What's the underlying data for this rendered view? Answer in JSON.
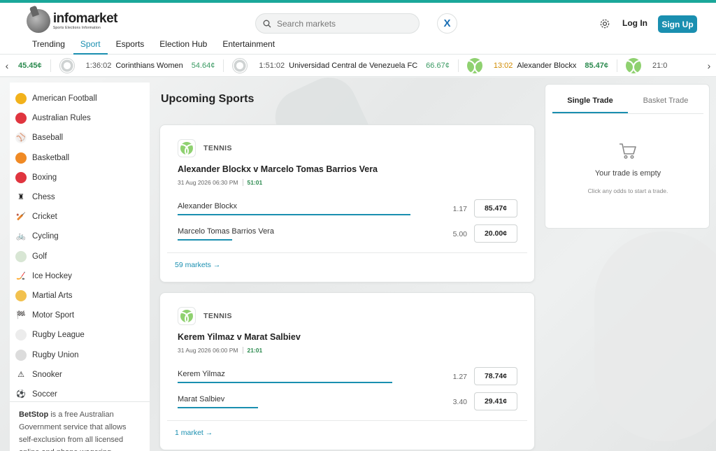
{
  "brand": {
    "name": "infomarket",
    "tagline": "Sports Elections Information"
  },
  "header": {
    "search_placeholder": "Search markets",
    "x_label": "X",
    "login_label": "Log In",
    "signup_label": "Sign Up"
  },
  "nav": {
    "tabs": [
      {
        "label": "Trending",
        "active": false
      },
      {
        "label": "Sport",
        "active": true
      },
      {
        "label": "Esports",
        "active": false
      },
      {
        "label": "Election Hub",
        "active": false
      },
      {
        "label": "Entertainment",
        "active": false
      }
    ]
  },
  "ticker": {
    "prev": "‹",
    "next": "›",
    "items": [
      {
        "price": "45.45¢"
      },
      {
        "ball": "soccer",
        "time": "1:36:02",
        "team": "Corinthians Women",
        "price": "54.64¢"
      },
      {
        "ball": "soccer",
        "time": "1:51:02",
        "team": "Universidad Central de Venezuela FC",
        "price": "66.67¢"
      },
      {
        "ball": "tennis",
        "time": "13:02",
        "team": "Alexander Blockx",
        "price": "85.47¢"
      },
      {
        "ball": "tennis",
        "time": "21:0"
      }
    ]
  },
  "sidebar": {
    "sports": [
      {
        "label": "American Football",
        "icon": "football-helmet-icon",
        "color": "#f2b21c",
        "glyph": ""
      },
      {
        "label": "Australian Rules",
        "icon": "australian-rules-ball-icon",
        "color": "#e0353f",
        "glyph": ""
      },
      {
        "label": "Baseball",
        "icon": "baseball-icon",
        "color": "#f4f4f4",
        "glyph": "⚾"
      },
      {
        "label": "Basketball",
        "icon": "basketball-icon",
        "color": "#f08a24",
        "glyph": ""
      },
      {
        "label": "Boxing",
        "icon": "boxing-glove-icon",
        "color": "#e0353f",
        "glyph": ""
      },
      {
        "label": "Chess",
        "icon": "chess-piece-icon",
        "color": "#ffffff",
        "glyph": "♜"
      },
      {
        "label": "Cricket",
        "icon": "cricket-bat-icon",
        "color": "#ffffff",
        "glyph": "🏏"
      },
      {
        "label": "Cycling",
        "icon": "bicycle-icon",
        "color": "#ffffff",
        "glyph": "🚲"
      },
      {
        "label": "Golf",
        "icon": "golf-ball-icon",
        "color": "#d8e6d4",
        "glyph": ""
      },
      {
        "label": "Ice Hockey",
        "icon": "hockey-sticks-icon",
        "color": "#ffffff",
        "glyph": "🏒"
      },
      {
        "label": "Martial Arts",
        "icon": "martial-arts-icon",
        "color": "#f2c14e",
        "glyph": ""
      },
      {
        "label": "Motor Sport",
        "icon": "checkered-flag-icon",
        "color": "#ffffff",
        "glyph": "🏁"
      },
      {
        "label": "Rugby League",
        "icon": "rugby-league-ball-icon",
        "color": "#ececec",
        "glyph": ""
      },
      {
        "label": "Rugby Union",
        "icon": "rugby-union-ball-icon",
        "color": "#dcdcdc",
        "glyph": ""
      },
      {
        "label": "Snooker",
        "icon": "snooker-triangle-icon",
        "color": "#ffffff",
        "glyph": "⚠"
      },
      {
        "label": "Soccer",
        "icon": "soccer-ball-icon",
        "color": "#ffffff",
        "glyph": "⚽"
      }
    ],
    "betstop": {
      "name": "BetStop",
      "text": " is a free Australian Government service that allows self-exclusion from all licensed online and phone wagering"
    }
  },
  "main": {
    "title": "Upcoming Sports",
    "cards": [
      {
        "category": "TENNIS",
        "title": "Alexander Blockx v Marcelo Tomas Barrios Vera",
        "date": "31 Aug 2026 06:30 PM",
        "countdown": "51:01",
        "runners": [
          {
            "name": "Alexander Blockx",
            "odds": "1.17",
            "price": "85.47¢",
            "share": 0.8547
          },
          {
            "name": "Marcelo Tomas Barrios Vera",
            "odds": "5.00",
            "price": "20.00¢",
            "share": 0.2
          }
        ],
        "markets_link": "59 markets →"
      },
      {
        "category": "TENNIS",
        "title": "Kerem Yilmaz v Marat Salbiev",
        "date": "31 Aug 2026 06:00 PM",
        "countdown": "21:01",
        "runners": [
          {
            "name": "Kerem Yilmaz",
            "odds": "1.27",
            "price": "78.74¢",
            "share": 0.7874
          },
          {
            "name": "Marat Salbiev",
            "odds": "3.40",
            "price": "29.41¢",
            "share": 0.2941
          }
        ],
        "markets_link": "1 market →"
      }
    ]
  },
  "trade": {
    "tabs": [
      {
        "label": "Single Trade",
        "active": true
      },
      {
        "label": "Basket Trade",
        "active": false
      }
    ],
    "empty_title": "Your trade is empty",
    "empty_hint": "Click any odds to start a trade."
  },
  "colors": {
    "accent": "#1a8fb0",
    "brand_stripe": "#1aa79a",
    "positive": "#2b8a4e"
  }
}
